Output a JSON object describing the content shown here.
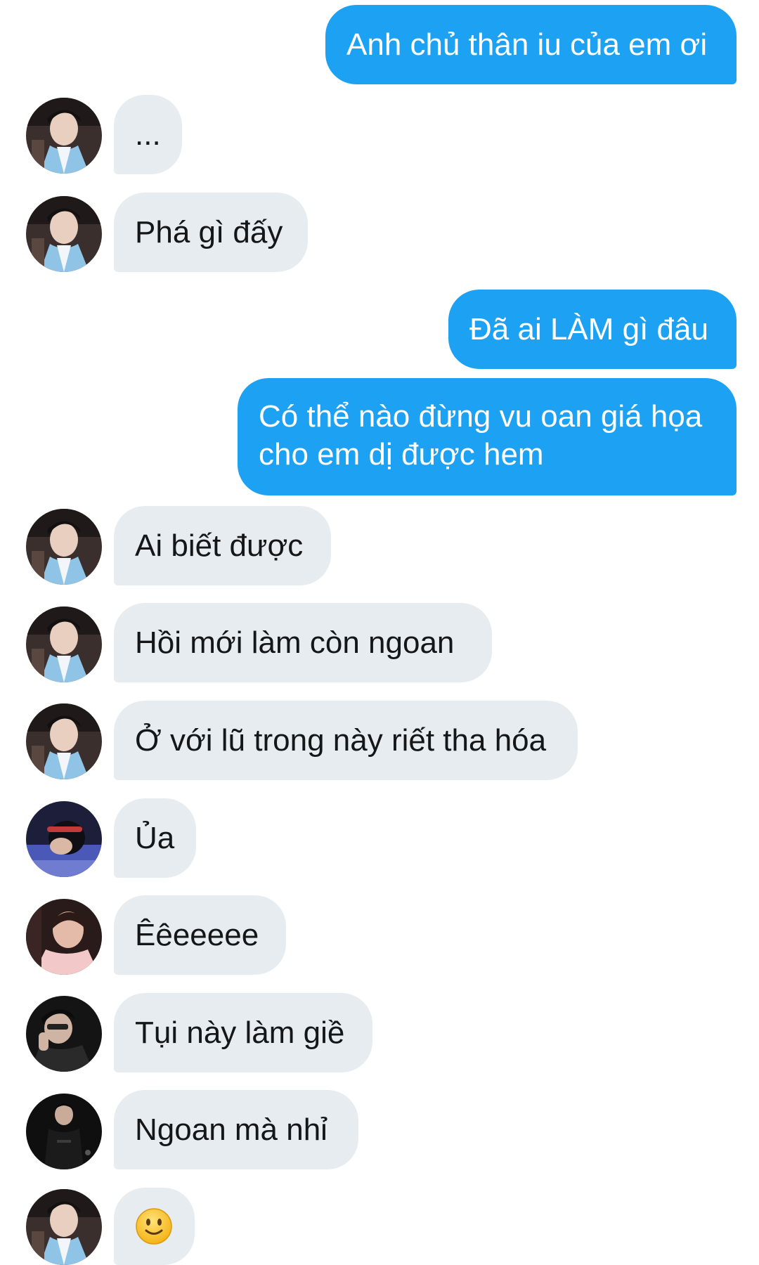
{
  "conversation": {
    "messages": [
      {
        "from": "me",
        "text": "Anh chủ thân iu của em ơi"
      },
      {
        "from": "hanbok",
        "text": "..."
      },
      {
        "from": "hanbok",
        "text": "Phá gì đấy"
      },
      {
        "from": "me",
        "text": "Đã ai LÀM gì đâu"
      },
      {
        "from": "me",
        "text": "Có thể nào đừng vu oan giá họa cho em dị được hem"
      },
      {
        "from": "hanbok",
        "text": "Ai biết được"
      },
      {
        "from": "hanbok",
        "text": "Hồi mới làm còn ngoan"
      },
      {
        "from": "hanbok",
        "text": "Ở với lũ trong này riết tha hóa"
      },
      {
        "from": "gamer",
        "text": "Ủa"
      },
      {
        "from": "pink-jacket",
        "text": "Êêeeeee"
      },
      {
        "from": "dark-hoodie",
        "text": "Tụi này làm giề"
      },
      {
        "from": "black-outfit",
        "text": "Ngoan mà nhỉ"
      },
      {
        "from": "hanbok",
        "emoji": "slightly-smiling-face-icon"
      }
    ]
  },
  "colors": {
    "sent_bubble": "#1da1f2",
    "received_bubble": "#e6ecf0",
    "sent_text": "#ffffff",
    "received_text": "#14171a"
  }
}
